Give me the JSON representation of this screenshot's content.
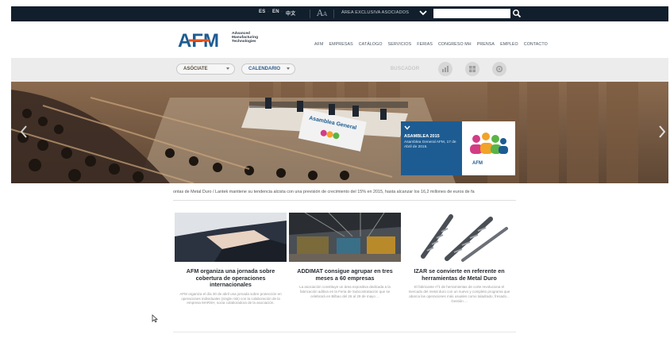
{
  "topbar": {
    "languages": [
      "ES",
      "EN",
      "中文"
    ],
    "area_link": "ÁREA EXCLUSIVA ASOCIADOS",
    "search_placeholder": ""
  },
  "header": {
    "logo_letters": "AFM",
    "logo_tagline": [
      "Advanced",
      "Manufacturing",
      "Technologies"
    ],
    "nav": [
      "AFM",
      "EMPRESAS",
      "CATÁLOGO",
      "SERVICIOS",
      "FERIAS",
      "CONGRESO MH",
      "PRENSA",
      "EMPLEO",
      "CONTACTO"
    ]
  },
  "subbar": {
    "asociate": "ASÓCIATE",
    "calendario": "CALENDARIO",
    "buscador": "BUSCADOR"
  },
  "hero": {
    "banner_text": "Asamblea General",
    "caption_title": "ASAMBLEA 2015",
    "caption_body": "Asamblea General AFM, 17 de Abril de 2015.",
    "thumb_logo": "AFM"
  },
  "ticker": "ontas de Metal Duro / Lantek mantiene su tendencia alcista con una previsión de crecimiento del 15% en 2015, hasta alcanzar los 16,2 millones de euros de fa",
  "articles": [
    {
      "title": "AFM organiza una jornada sobre cobertura de operaciones internacionales",
      "desc": "AFM organiza el día 30 de abril una jornada sobre protección en operaciones individuales (single risk) con la colaboración de la empresa MARSH, socia colaboradora de la asociación."
    },
    {
      "title": "ADDIMAT consigue agrupar en tres meses a 60 empresas",
      "desc": "La asociación constituye un área expositiva dedicada a la fabricación aditiva en la Feria de Subcontratación que se celebrará en Bilbao del 26 al 29 de mayo ..."
    },
    {
      "title": "IZAR se convierte en referente en herramientas de Metal Duro",
      "desc": "El fabricante nº1 de herramientas de corte revoluciona el mercado del metal duro con un nuevo y completo programa que abarca las operaciones más usuales como taladrado, fresado... Gestión ..."
    }
  ],
  "colors": {
    "topbar": "#111e2b",
    "brand_blue": "#1d5c92",
    "subbar": "#ececec",
    "pill_text": "#5a4e3e",
    "calendar_text": "#2b5a8c"
  }
}
